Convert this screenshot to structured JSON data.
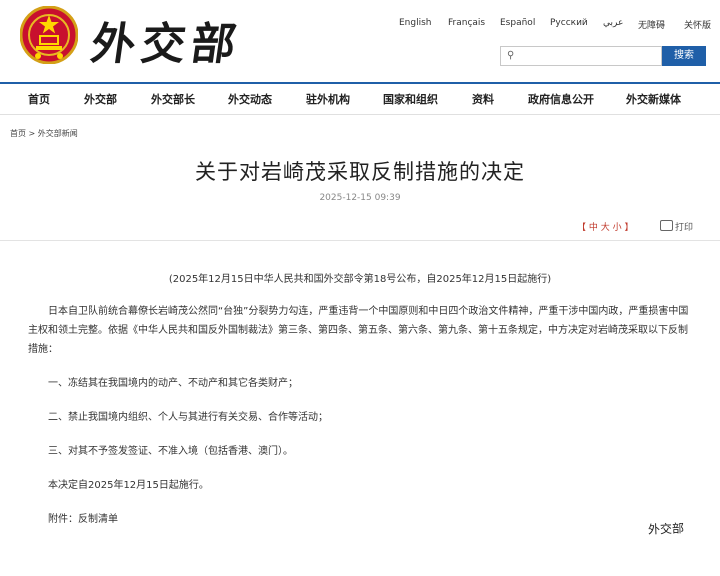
{
  "header": {
    "brand_text": "外交部",
    "languages": [
      "English",
      "Français",
      "Español",
      "Русский",
      "عربي",
      "无障碍",
      "关怀版"
    ],
    "search": {
      "placeholder": "",
      "button_label": "搜索"
    }
  },
  "nav": {
    "items": [
      "首页",
      "外交部",
      "外交部长",
      "外交动态",
      "驻外机构",
      "国家和组织",
      "资料",
      "政府信息公开",
      "外交新媒体"
    ]
  },
  "breadcrumb": {
    "home": "首页",
    "separator": ">",
    "section": "外交部新闻"
  },
  "article": {
    "title": "关于对岩崎茂采取反制措施的决定",
    "date": "2025-12-15 09:39",
    "font_size_controls": "【 中  大  小 】",
    "print_label": "打印",
    "subtitle": "(2025年12月15日中华人民共和国外交部令第18号公布，自2025年12月15日起施行)",
    "intro": "日本自卫队前统合幕僚长岩崎茂公然同“台独”分裂势力勾连，严重违背一个中国原则和中日四个政治文件精神，严重干涉中国内政，严重损害中国主权和领土完整。依据《中华人民共和国反外国制裁法》第三条、第四条、第五条、第六条、第九条、第十五条规定，中方决定对岩崎茂采取以下反制措施：",
    "measures": [
      "一、冻结其在我国境内的动产、不动产和其它各类财产；",
      "二、禁止我国境内组织、个人与其进行有关交易、合作等活动；",
      "三、对其不予签发签证、不准入境（包括香港、澳门）。"
    ],
    "effective": "本决定自2025年12月15日起施行。",
    "attachment": "附件：反制清单"
  },
  "watermark_text": "外交部"
}
